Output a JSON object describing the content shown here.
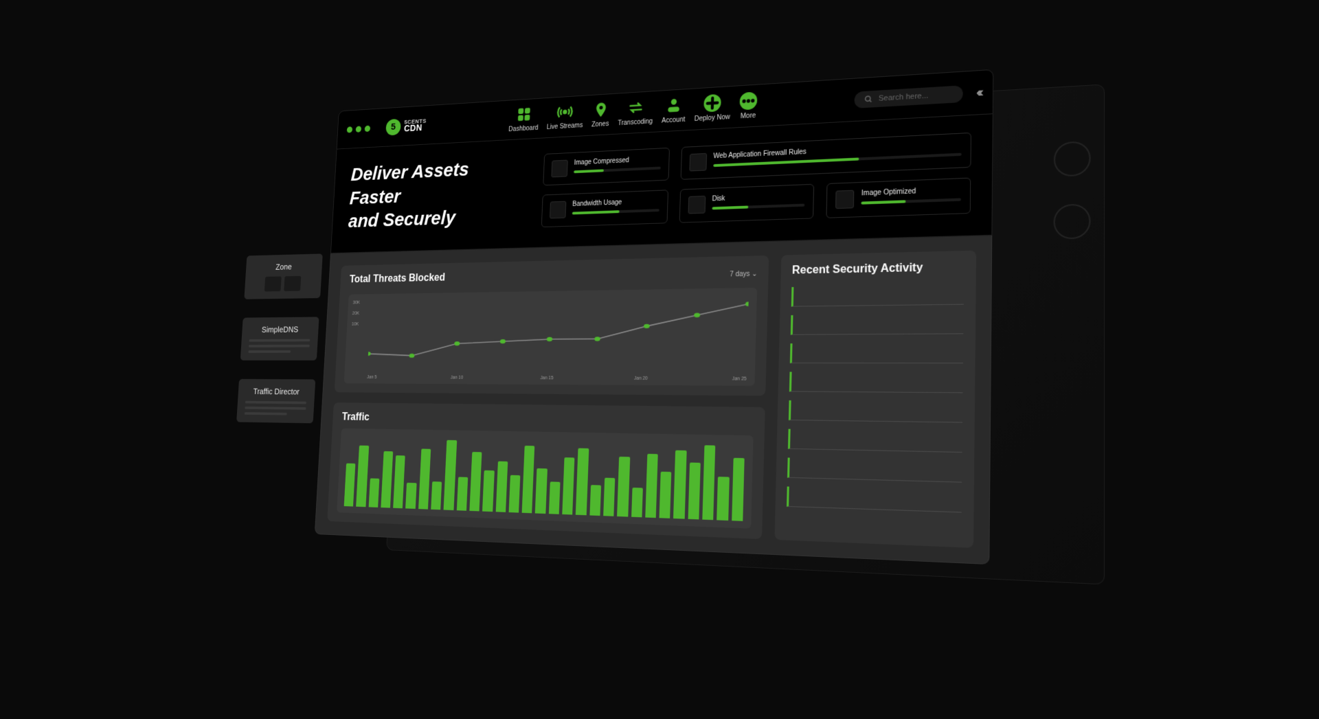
{
  "brand": {
    "badge": "5",
    "line1": "5CENTS",
    "line2": "CDN"
  },
  "nav": {
    "items": [
      {
        "label": "Dashboard",
        "icon": "grid-icon"
      },
      {
        "label": "Live Streams",
        "icon": "broadcast-icon"
      },
      {
        "label": "Zones",
        "icon": "pin-icon"
      },
      {
        "label": "Transcoding",
        "icon": "swap-icon"
      },
      {
        "label": "Account",
        "icon": "account-icon"
      },
      {
        "label": "Deploy Now",
        "icon": "plus-icon",
        "filled": true
      },
      {
        "label": "More",
        "icon": "more-icon",
        "filled": true
      }
    ]
  },
  "search": {
    "placeholder": "Search here..."
  },
  "hero": {
    "title_line1": "Deliver Assets Faster",
    "title_line2": "and Securely"
  },
  "stats": {
    "cards": [
      {
        "label": "Image Compressed",
        "progress": 35
      },
      {
        "label": "Web Application Firewall Rules",
        "progress": 60
      },
      {
        "label": "Bandwidth Usage",
        "progress": 55
      },
      {
        "label": "Disk",
        "progress": 40
      },
      {
        "label": "Image Optimized",
        "progress": 45
      }
    ]
  },
  "floaters": [
    {
      "title": "Zone",
      "style": "blocks"
    },
    {
      "title": "SimpleDNS",
      "style": "lines"
    },
    {
      "title": "Traffic Director",
      "style": "lines"
    }
  ],
  "threats": {
    "title": "Total Threats Blocked",
    "range": "7 days",
    "y_ticks": [
      "30K",
      "20K",
      "10K"
    ],
    "x_ticks": [
      "Jan 5",
      "Jan 10",
      "Jan 15",
      "Jan 20",
      "Jan 25"
    ]
  },
  "traffic": {
    "title": "Traffic"
  },
  "activity": {
    "title": "Recent Security Activity",
    "rows": 8
  },
  "chart_data": [
    {
      "type": "line",
      "title": "Total Threats Blocked",
      "xlabel": "",
      "ylabel": "",
      "ylim": [
        0,
        35000
      ],
      "y_ticks": [
        "10K",
        "20K",
        "30K"
      ],
      "categories": [
        "Jan 5",
        "Jan 10",
        "Jan 15",
        "Jan 20",
        "Jan 25"
      ],
      "values": [
        7000,
        6000,
        12000,
        13000,
        14000,
        14000,
        20000,
        25000,
        30000
      ]
    },
    {
      "type": "bar",
      "title": "Traffic",
      "xlabel": "",
      "ylabel": "",
      "ylim": [
        0,
        100
      ],
      "categories": [],
      "values": [
        60,
        85,
        40,
        78,
        72,
        35,
        82,
        38,
        95,
        45,
        80,
        55,
        68,
        50,
        90,
        60,
        42,
        75,
        88,
        40,
        50,
        78,
        38,
        82,
        60,
        88,
        72,
        95,
        55,
        80
      ]
    }
  ]
}
